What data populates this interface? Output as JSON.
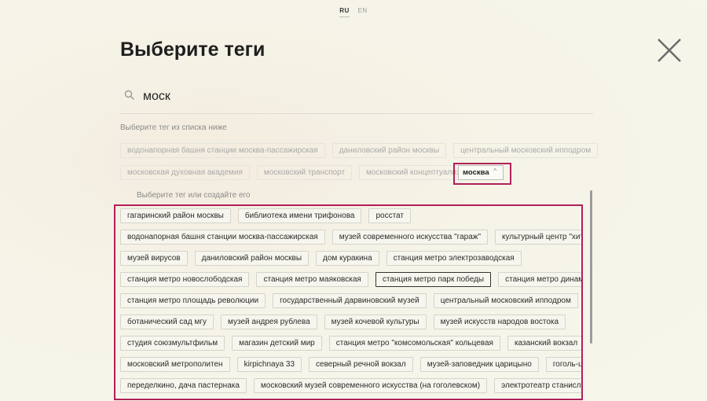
{
  "lang": {
    "active": "RU",
    "inactive": "EN"
  },
  "title": "Выберите теги",
  "search": {
    "value": "моск"
  },
  "hint": "Выберите тег из списка ниже",
  "suggestion_rows": [
    [
      "водонапорная башня станции москва-пассажирская",
      "даниловский район москвы",
      "центральный московский ипподром"
    ],
    [
      "московская духовная академия",
      "московский транспорт",
      "московский концептуализм"
    ]
  ],
  "selected_tag": {
    "label": "москва",
    "caret": "^"
  },
  "sub_hint": "Выберите тег или создайте его",
  "tag_rows": [
    [
      "гагаринский район москвы",
      "библиотека имени трифонова",
      "росстат"
    ],
    [
      "водонапорная башня станции москва-пассажирская",
      "музей современного искусства \"гараж\"",
      "культурный центр \"хитровка\""
    ],
    [
      "музей вирусов",
      "даниловский район москвы",
      "дом куракина",
      "станция метро электрозаводская"
    ],
    [
      "станция метро новослободская",
      "станция метро маяковская",
      "станция метро парк победы",
      "станция метро динамо"
    ],
    [
      "станция метро площадь революции",
      "государственный дарвиновский музей",
      "центральный московский ипподром"
    ],
    [
      "ботанический сад мгу",
      "музей андрея рублева",
      "музей кочевой культуры",
      "музей искусств народов востока"
    ],
    [
      "студия союзмультфильм",
      "магазин детский мир",
      "станция метро \"комсомольская\" кольцевая",
      "казанский вокзал"
    ],
    [
      "московский метрополитен",
      "kirpichnaya 33",
      "северный речной вокзал",
      "музей-заповедник царицыно",
      "гоголь-центр"
    ],
    [
      "переделкино, дача пастернака",
      "московский музей современного искусства (на гоголевском)",
      "электротеатр станиславский"
    ],
    [
      "",
      "",
      "",
      "",
      ""
    ]
  ]
}
